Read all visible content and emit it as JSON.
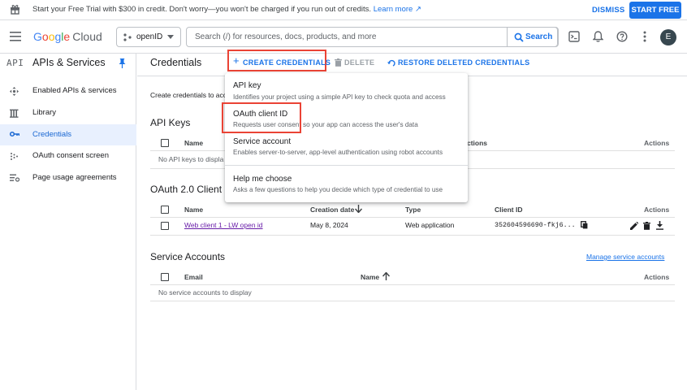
{
  "banner": {
    "message": "Start your Free Trial with $300 in credit. Don't worry—you won't be charged if you run out of credits.",
    "learn_more": "Learn more",
    "dismiss": "DISMISS",
    "start_free": "START FREE"
  },
  "topbar": {
    "logo_google": [
      "G",
      "o",
      "o",
      "g",
      "l",
      "e"
    ],
    "logo_cloud": "Cloud",
    "project": "openID",
    "search_placeholder": "Search (/) for resources, docs, products, and more",
    "search_button": "Search",
    "avatar_initial": "E"
  },
  "sidebar": {
    "api_mark": "API",
    "title": "APIs & Services",
    "items": [
      {
        "label": "Enabled APIs & services",
        "icon": "enabled-apis-icon"
      },
      {
        "label": "Library",
        "icon": "library-icon"
      },
      {
        "label": "Credentials",
        "icon": "key-icon",
        "active": true
      },
      {
        "label": "OAuth consent screen",
        "icon": "consent-icon"
      },
      {
        "label": "Page usage agreements",
        "icon": "agreements-icon"
      }
    ]
  },
  "header": {
    "title": "Credentials",
    "create": "CREATE CREDENTIALS",
    "delete": "DELETE",
    "restore": "RESTORE DELETED CREDENTIALS"
  },
  "intro": "Create credentials to acc",
  "api_keys": {
    "title": "API Keys",
    "col_name": "Name",
    "col_restrictions": "ctions",
    "col_actions": "Actions",
    "empty": "No API keys to displa"
  },
  "oauth": {
    "title": "OAuth 2.0 Client I",
    "columns": {
      "name": "Name",
      "created": "Creation date",
      "type": "Type",
      "client_id": "Client ID",
      "actions": "Actions"
    },
    "rows": [
      {
        "name": "Web client 1 - LW open id",
        "created": "May 8, 2024",
        "type": "Web application",
        "client_id": "352604596690-fkj6..."
      }
    ]
  },
  "service_accounts": {
    "title": "Service Accounts",
    "manage": "Manage service accounts",
    "col_email": "Email",
    "col_name": "Name",
    "col_actions": "Actions",
    "empty": "No service accounts to display"
  },
  "menu": {
    "items": [
      {
        "title": "API key",
        "desc": "Identifies your project using a simple API key to check quota and access"
      },
      {
        "title": "OAuth client ID",
        "desc": "Requests user consent so your app can access the user's data"
      },
      {
        "title": "Service account",
        "desc": "Enables server-to-server, app-level authentication using robot accounts"
      },
      {
        "title": "Help me choose",
        "desc": "Asks a few questions to help you decide which type of credential to use"
      }
    ]
  },
  "colors": {
    "accent": "#1a73e8",
    "highlight": "#ea4335",
    "active_bg": "#e8f0fe"
  }
}
